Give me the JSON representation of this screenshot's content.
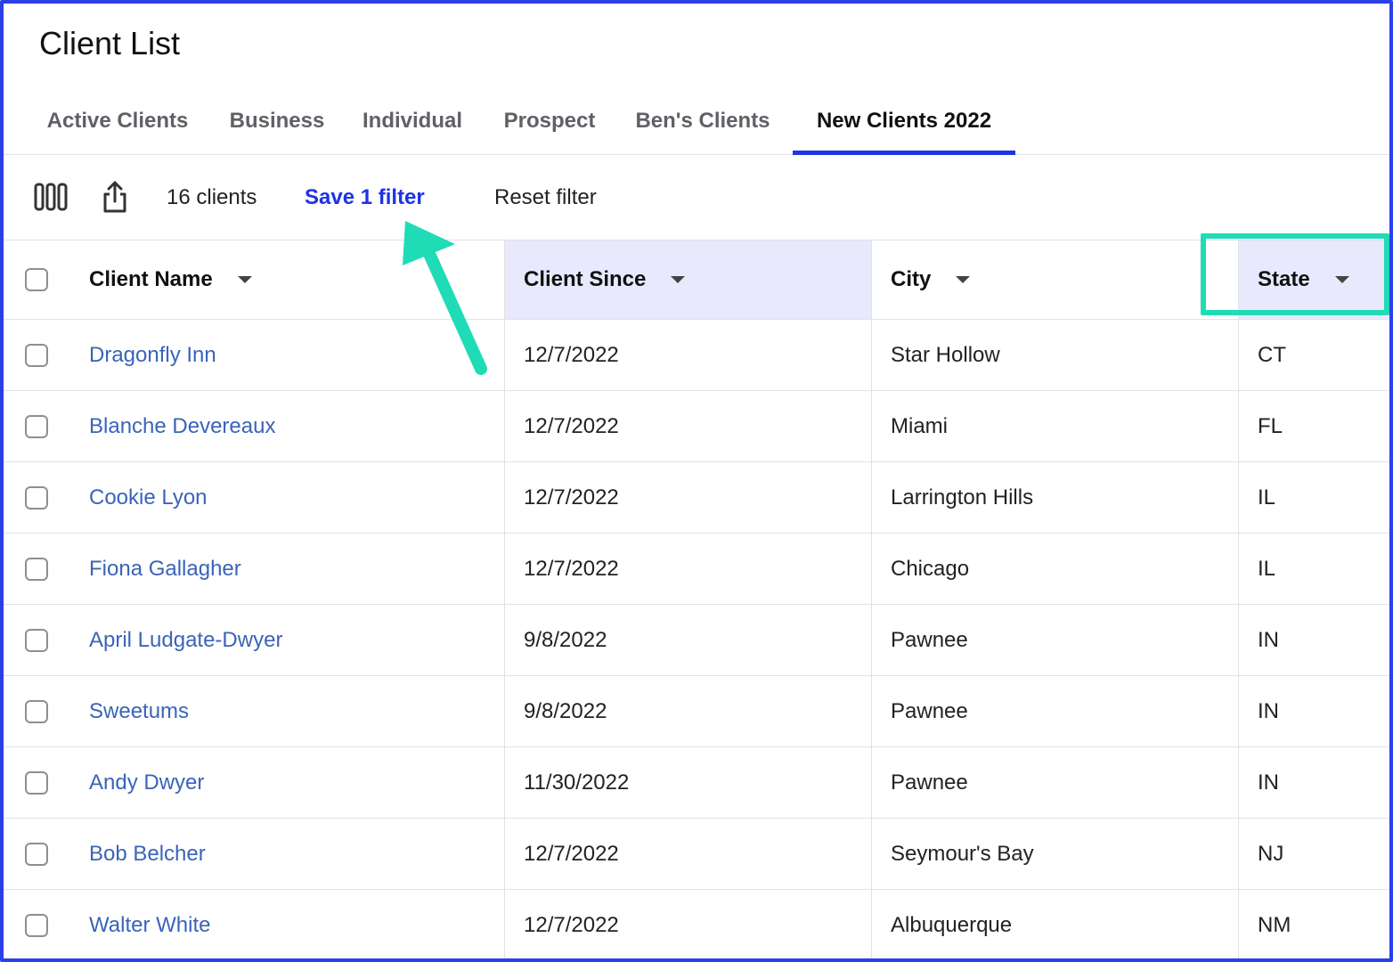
{
  "page": {
    "title": "Client List"
  },
  "tabs": [
    {
      "label": "Active Clients"
    },
    {
      "label": "Business"
    },
    {
      "label": "Individual"
    },
    {
      "label": "Prospect"
    },
    {
      "label": "Ben's Clients"
    },
    {
      "label": "New Clients 2022",
      "active": true
    }
  ],
  "toolbar": {
    "columns_icon": "columns-icon",
    "export_icon": "share-export-icon",
    "count": "16 clients",
    "save_filter": "Save 1 filter",
    "reset_filter": "Reset filter"
  },
  "table": {
    "columns": [
      "Client Name",
      "Client Since",
      "City",
      "State"
    ],
    "highlighted_columns": [
      "Client Since",
      "State"
    ],
    "rows": [
      {
        "name": "Dragonfly Inn",
        "since": "12/7/2022",
        "city": "Star Hollow",
        "state": "CT"
      },
      {
        "name": "Blanche Devereaux",
        "since": "12/7/2022",
        "city": "Miami",
        "state": "FL"
      },
      {
        "name": "Cookie Lyon",
        "since": "12/7/2022",
        "city": "Larrington Hills",
        "state": "IL"
      },
      {
        "name": "Fiona Gallagher",
        "since": "12/7/2022",
        "city": "Chicago",
        "state": "IL"
      },
      {
        "name": "April Ludgate-Dwyer",
        "since": "9/8/2022",
        "city": "Pawnee",
        "state": "IN"
      },
      {
        "name": "Sweetums",
        "since": "9/8/2022",
        "city": "Pawnee",
        "state": "IN"
      },
      {
        "name": "Andy Dwyer",
        "since": "11/30/2022",
        "city": "Pawnee",
        "state": "IN"
      },
      {
        "name": "Bob Belcher",
        "since": "12/7/2022",
        "city": "Seymour's Bay",
        "state": "NJ"
      },
      {
        "name": "Walter White",
        "since": "12/7/2022",
        "city": "Albuquerque",
        "state": "NM"
      }
    ]
  },
  "colors": {
    "accent": "#1d33e6",
    "link": "#3a64b8",
    "annotation": "#1fdcb6",
    "highlight_header": "#e8e9fd",
    "frame": "#2b40e8"
  },
  "annotations": {
    "arrow_icon": "annotation-arrow",
    "highlight_box": "state-column-highlight"
  }
}
